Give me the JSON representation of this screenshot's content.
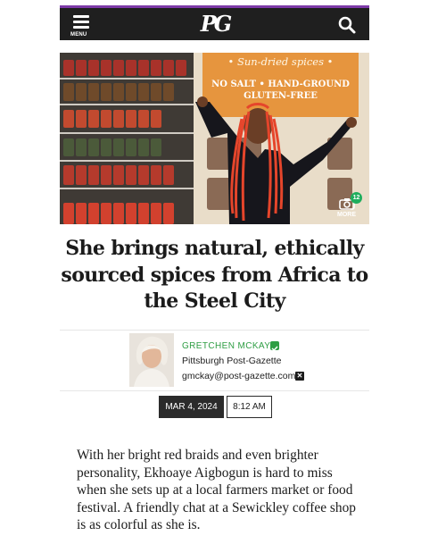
{
  "header": {
    "menu_label": "MENU",
    "logo_text": "PG",
    "accent_color": "#7d3aa8",
    "icons": [
      "hamburger-icon",
      "search-icon"
    ]
  },
  "hero": {
    "banner_line1": "• Sun-dried spices •",
    "banner_line2": "NO SALT • HAND-GROUND",
    "banner_line3": "GLUTEN-FREE",
    "photo_count": "12",
    "more_label": "MORE"
  },
  "article": {
    "headline": "She brings natural, ethically sourced spices from Africa to the Steel City",
    "author": "GRETCHEN MCKAY",
    "publication": "Pittsburgh Post-Gazette",
    "email": "gmckay@post-gazette.com",
    "date": "MAR 4, 2024",
    "time": "8:12 AM",
    "body": "With her bright red braids and even brighter personality, Ekhoaye Aigbogun is hard to miss when she sets up at a local farmers market or food festival. A friendly chat at a Sewickley coffee shop is as colorful as she is."
  },
  "colors": {
    "author_green": "#2f9e44",
    "header_bg": "#1f1f1f"
  }
}
